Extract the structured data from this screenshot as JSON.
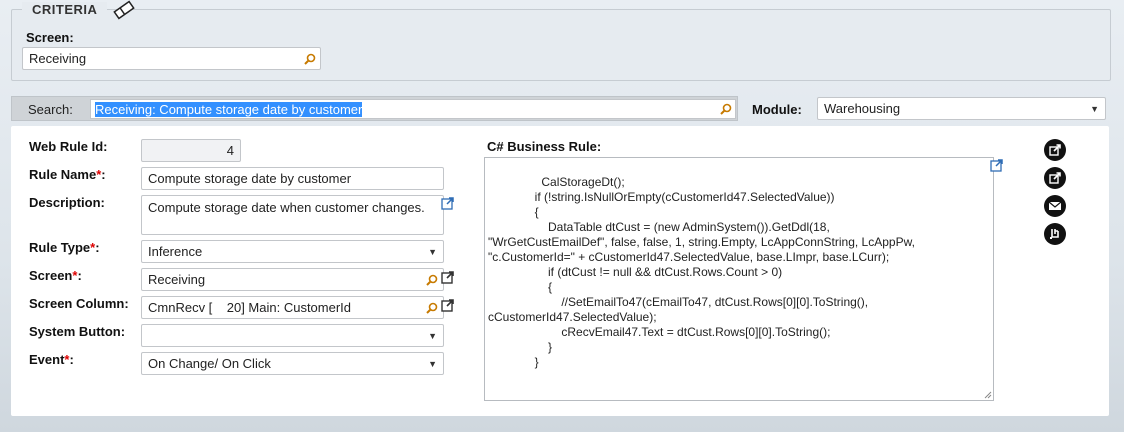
{
  "criteria": {
    "legend": "CRITERIA",
    "screen_label": "Screen:",
    "screen_value": "Receiving"
  },
  "search": {
    "label": "Search:",
    "value": "Receiving: Compute storage date by customer"
  },
  "module": {
    "label": "Module:",
    "value": "Warehousing"
  },
  "form": {
    "web_rule_id_label": "Web Rule Id:",
    "web_rule_id_value": "4",
    "rule_name_label": "Rule Name",
    "rule_name_value": "Compute storage date by customer",
    "description_label": "Description:",
    "description_value": "Compute storage date when customer changes.",
    "rule_type_label": "Rule Type",
    "rule_type_value": "Inference",
    "screen_label": "Screen",
    "screen_value": "Receiving",
    "screen_column_label": "Screen Column:",
    "screen_column_value": "CmnRecv [    20] Main: CustomerId",
    "system_button_label": "System Button:",
    "system_button_value": "",
    "event_label": "Event",
    "event_value": "On Change/ On Click",
    "required_mark": "*",
    "colon": ":"
  },
  "code": {
    "label": "C# Business Rule:",
    "text": "              CalStorageDt();\n              if (!string.IsNullOrEmpty(cCustomerId47.SelectedValue))\n              {\n                  DataTable dtCust = (new AdminSystem()).GetDdl(18,\n\"WrGetCustEmailDef\", false, false, 1, string.Empty, LcAppConnString, LcAppPw,\n\"c.CustomerId=\" + cCustomerId47.SelectedValue, base.LImpr, base.LCurr);\n                  if (dtCust != null && dtCust.Rows.Count > 0)\n                  {\n                      //SetEmailTo47(cEmailTo47, dtCust.Rows[0][0].ToString(),\ncCustomerId47.SelectedValue);\n                      cRecvEmail47.Text = dtCust.Rows[0][0].ToString();\n                  }\n              }"
  },
  "colors": {
    "highlight": "#3390ff",
    "required": "#dd0000",
    "panel": "#ffffff"
  }
}
